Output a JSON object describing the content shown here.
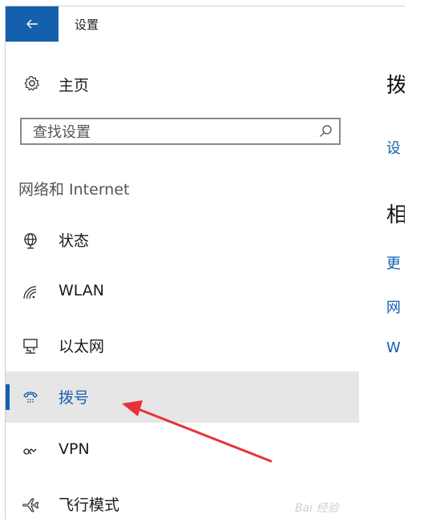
{
  "window": {
    "title": "设置",
    "back_label": "←"
  },
  "sidebar": {
    "home_label": "主页",
    "search": {
      "placeholder": "查找设置",
      "value": ""
    },
    "section_title": "网络和 Internet",
    "items": [
      {
        "label": "状态",
        "icon": "globe-icon",
        "selected": false
      },
      {
        "label": "WLAN",
        "icon": "wifi-icon",
        "selected": false
      },
      {
        "label": "以太网",
        "icon": "ethernet-icon",
        "selected": false
      },
      {
        "label": "拨号",
        "icon": "dialup-icon",
        "selected": true
      },
      {
        "label": "VPN",
        "icon": "vpn-icon",
        "selected": false
      },
      {
        "label": "飞行模式",
        "icon": "airplane-icon",
        "selected": false
      }
    ]
  },
  "content": {
    "heading1": "拨",
    "link1": "设",
    "heading2": "相",
    "link2": "更",
    "link3": "网",
    "link4": "W"
  },
  "watermark": "Bai 经验",
  "colors": {
    "accent": "#1560ad",
    "selected_bg": "#e6e6e6",
    "annotation": "#e8323a"
  }
}
